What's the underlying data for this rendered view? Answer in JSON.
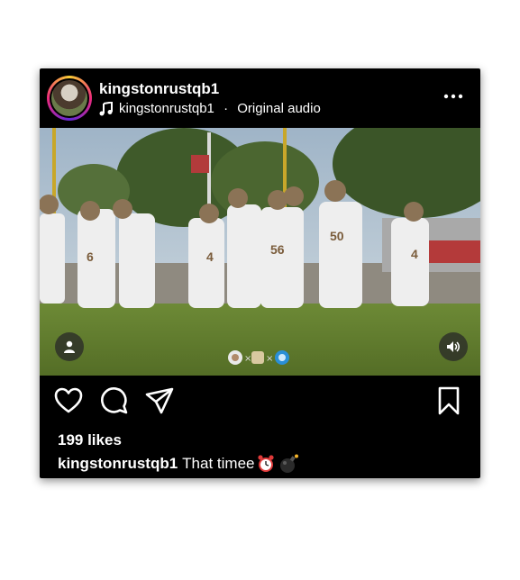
{
  "post": {
    "username": "kingstonrustqb1",
    "audio_user": "kingstonrustqb1",
    "audio_sep": " · ",
    "audio_label": "Original audio",
    "likes": "199 likes",
    "caption_user": "kingstonrustqb1",
    "caption_text": "That timee",
    "caption_emojis": [
      "alarm-clock",
      "bomb"
    ]
  },
  "media": {
    "jerseys": [
      "6",
      "4",
      "56",
      "50",
      "4"
    ]
  },
  "icons": {
    "avatar": "profile-avatar",
    "audio": "music-note-icon",
    "more": "more-dots-icon",
    "user_tag": "user-tag-icon",
    "sound": "speaker-icon",
    "like": "heart-icon",
    "comment": "comment-icon",
    "share": "send-icon",
    "save": "bookmark-icon"
  },
  "colors": {
    "background": "#000000",
    "text": "#ffffff",
    "field": "#5f7a2e",
    "sky": "#b8c9d6",
    "uniform": "#f2f2f2",
    "helmet": "#8b7356"
  }
}
